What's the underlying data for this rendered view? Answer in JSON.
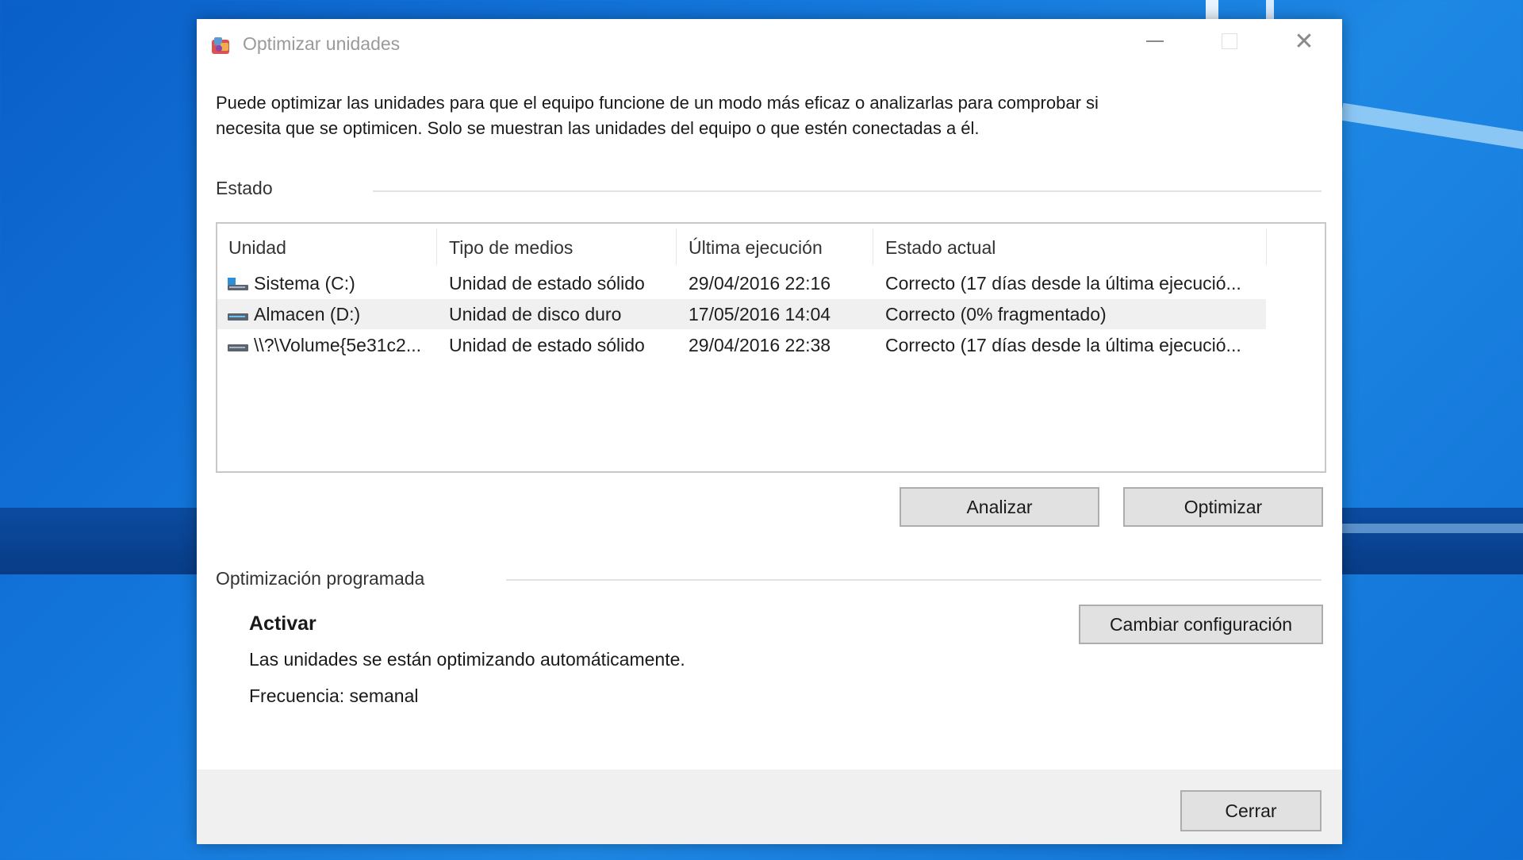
{
  "window": {
    "title": "Optimizar unidades"
  },
  "intro": {
    "line1": "Puede optimizar las unidades para que el equipo funcione de un modo más eficaz o analizarlas para comprobar si",
    "line2": "necesita que se optimicen. Solo se muestran las unidades del equipo o que estén conectadas a él."
  },
  "status_section": {
    "label": "Estado",
    "columns": [
      "Unidad",
      "Tipo de medios",
      "Última ejecución",
      "Estado actual"
    ],
    "rows": [
      {
        "drive": "Sistema (C:)",
        "media": "Unidad de estado sólido",
        "last_run": "29/04/2016 22:16",
        "status": "Correcto (17 días desde la última ejecució...",
        "icon": "system-drive-icon"
      },
      {
        "drive": "Almacen (D:)",
        "media": "Unidad de disco duro",
        "last_run": "17/05/2016 14:04",
        "status": "Correcto (0% fragmentado)",
        "icon": "drive-icon"
      },
      {
        "drive": "\\\\?\\Volume{5e31c2...",
        "media": "Unidad de estado sólido",
        "last_run": "29/04/2016 22:38",
        "status": "Correcto (17 días desde la última ejecució...",
        "icon": "drive-icon"
      }
    ],
    "selected_row": 1,
    "analyze_button": "Analizar",
    "optimize_button": "Optimizar"
  },
  "schedule_section": {
    "label": "Optimización programada",
    "state": "Activar",
    "description": "Las unidades se están optimizando automáticamente.",
    "frequency": "Frecuencia: semanal",
    "change_button": "Cambiar configuración"
  },
  "footer": {
    "close_button": "Cerrar"
  },
  "colors": {
    "desktop": "#1478dc",
    "selected_row": "#f0f0f0",
    "button_face": "#e1e1e1"
  }
}
